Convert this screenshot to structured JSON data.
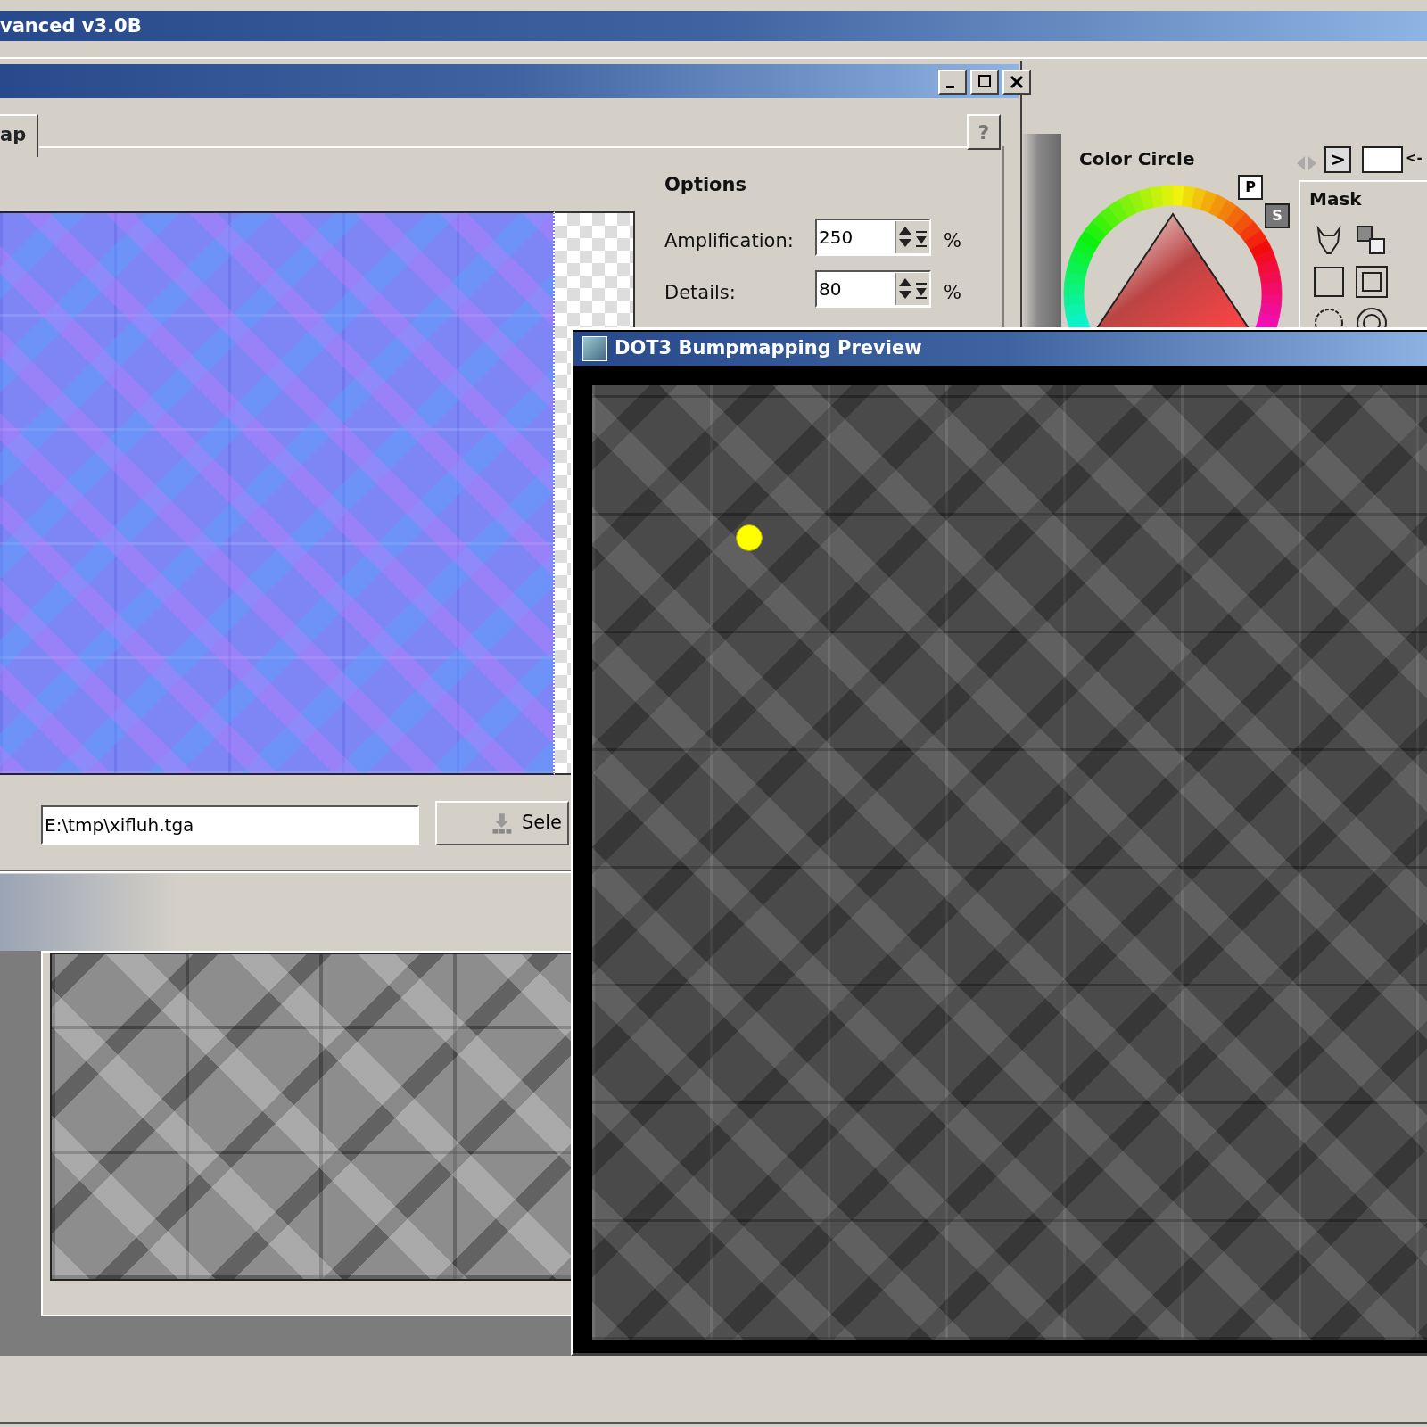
{
  "app_window": {
    "title": "vanced v3.0B"
  },
  "dialog": {
    "tabs": [
      {
        "label": "ap",
        "selected": true
      }
    ],
    "help_button": "?",
    "options": {
      "heading": "Options",
      "fields": [
        {
          "label": "Amplification:",
          "value": "250",
          "unit": "%"
        },
        {
          "label": "Details:",
          "value": "80",
          "unit": "%"
        }
      ]
    },
    "file_path": "E:\\tmp\\xifluh.tga",
    "select_button": "Sele"
  },
  "color_panel": {
    "title": "Color Circle",
    "play_button": ">",
    "swatch_label": "<-",
    "p_button": "P",
    "s_button": "S",
    "mask": {
      "title": "Mask"
    }
  },
  "preview_window": {
    "title": "DOT3 Bumpmapping Preview"
  }
}
